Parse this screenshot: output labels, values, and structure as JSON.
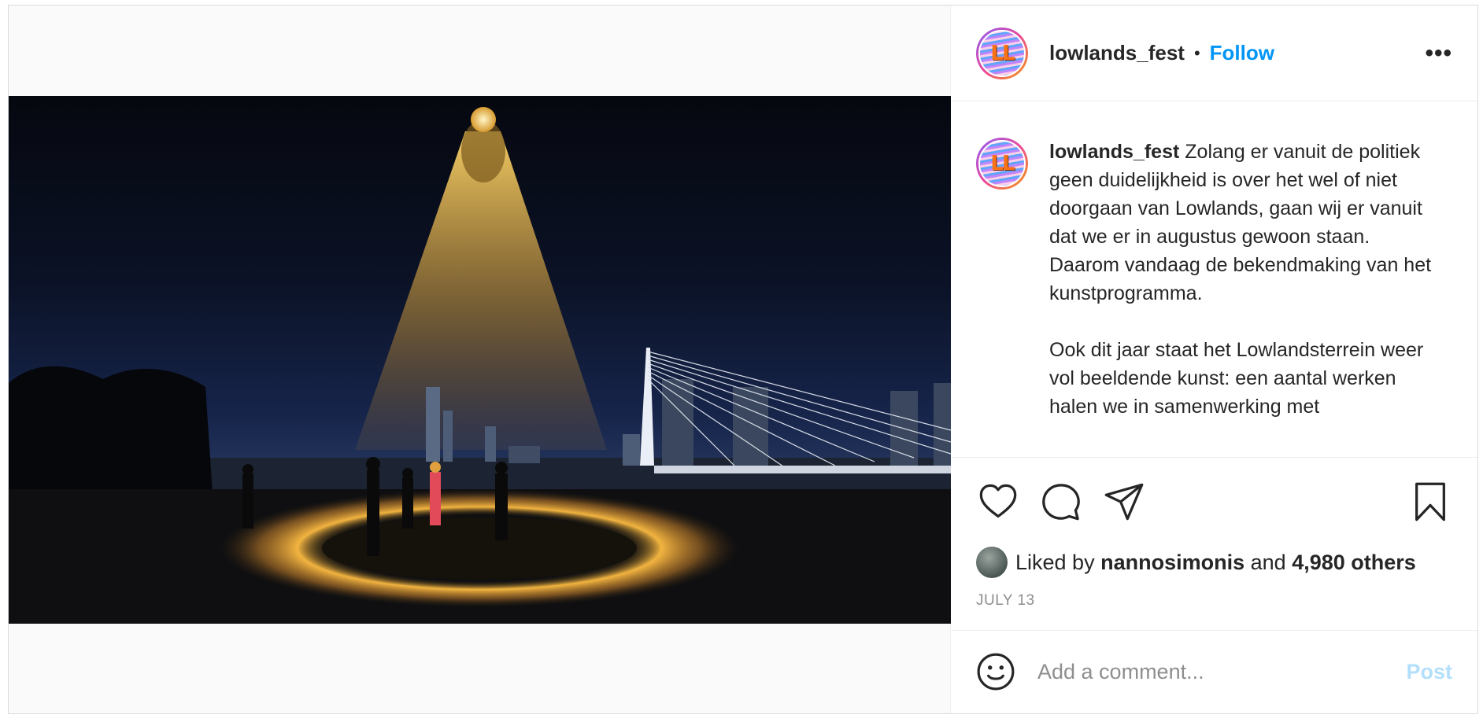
{
  "post": {
    "username": "lowlands_fest",
    "avatar_text": "LL",
    "follow_label": "Follow",
    "separator": "•",
    "more_label": "•••"
  },
  "caption": {
    "username": "lowlands_fest",
    "paragraph1": "Zolang er vanuit de politiek geen duidelijkheid is over het wel of niet doorgaan van Lowlands, gaan wij er vanuit dat we er in augustus gewoon staan. Daarom vandaag de bekendmaking van het kunstprogramma.",
    "paragraph2": "Ook dit jaar staat het Lowlandsterrein weer vol beeldende kunst: een aantal werken halen we in samenwerking met"
  },
  "likes": {
    "prefix": "Liked by",
    "user": "nannosimonis",
    "middle": "and",
    "others": "4,980 others"
  },
  "date": "JULY 13",
  "comment": {
    "placeholder": "Add a comment...",
    "post_label": "Post"
  },
  "icons": {
    "like": "heart-icon",
    "comment": "comment-icon",
    "share": "paper-plane-icon",
    "save": "bookmark-icon",
    "emoji": "smiley-icon"
  },
  "colors": {
    "link": "#0095f6",
    "post_disabled": "#b2dffc",
    "muted": "#8e8e8e"
  }
}
